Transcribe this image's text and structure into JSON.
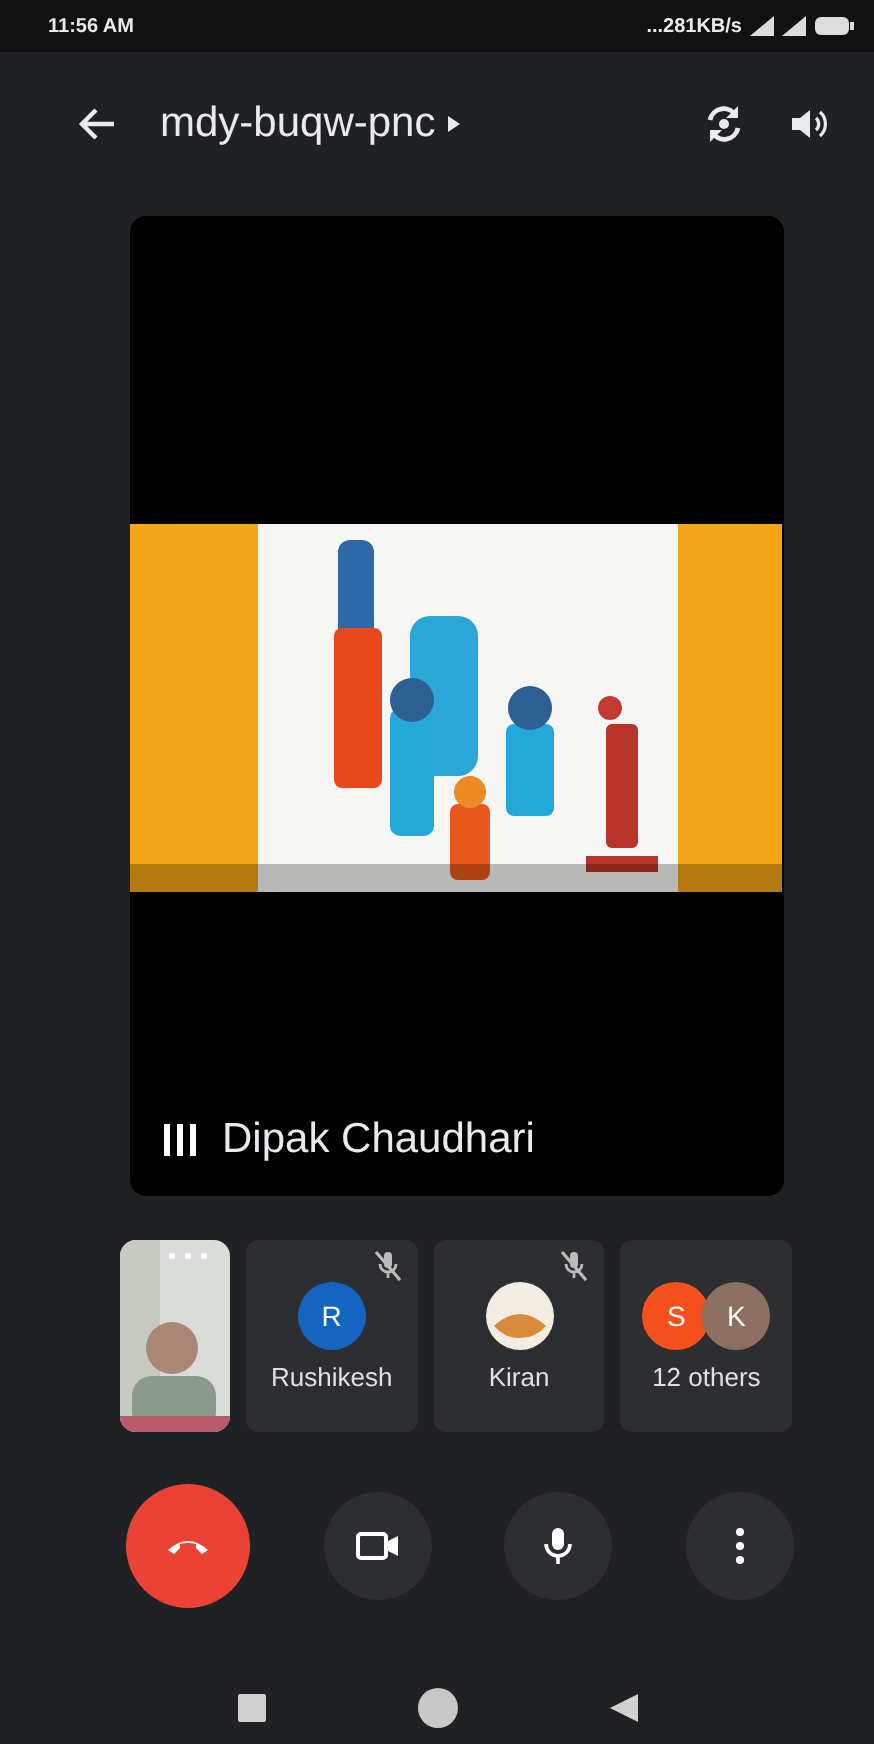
{
  "status_bar": {
    "time": "11:56 AM",
    "network_speed": "...281KB/s"
  },
  "top_bar": {
    "meeting_code": "mdy-buqw-pnc"
  },
  "main_tile": {
    "presenter": "Dipak Chaudhari"
  },
  "participants": [
    {
      "kind": "self"
    },
    {
      "kind": "initial",
      "initial": "R",
      "name": "Rushikesh",
      "muted": true,
      "color": "#1565c0"
    },
    {
      "name": "Kiran",
      "muted": true
    },
    {
      "kind": "group",
      "name": "12 others",
      "avatars": [
        {
          "initial": "S",
          "color": "#f4511e"
        },
        {
          "initial": "K",
          "color": "#8d6e63"
        }
      ]
    }
  ],
  "controls": [
    {
      "kind": "end_call"
    },
    {
      "kind": "camera"
    },
    {
      "kind": "mic"
    },
    {
      "kind": "more"
    }
  ]
}
